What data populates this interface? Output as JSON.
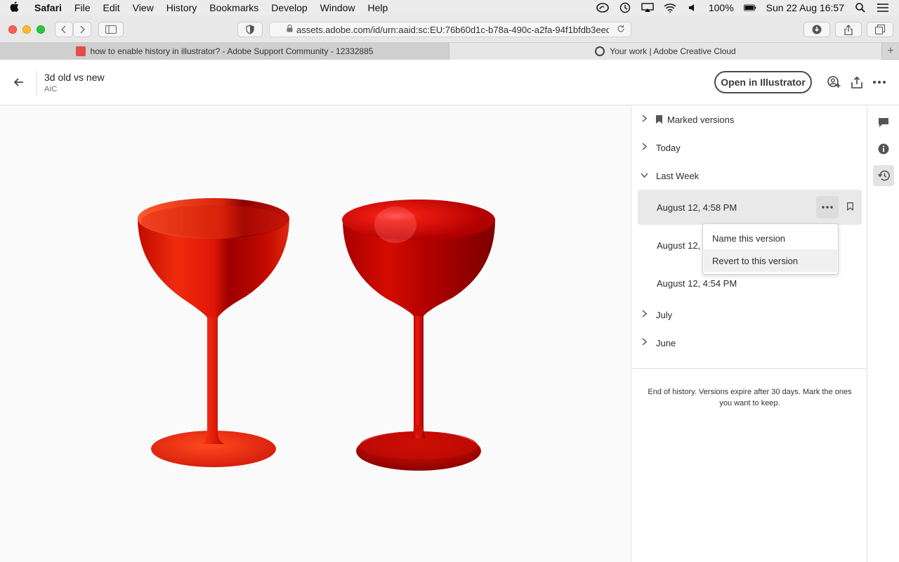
{
  "menubar": {
    "app_name": "Safari",
    "items": [
      "File",
      "Edit",
      "View",
      "History",
      "Bookmarks",
      "Develop",
      "Window",
      "Help"
    ],
    "battery": "100%",
    "clock": "Sun 22 Aug  16:57"
  },
  "toolbar": {
    "url": "assets.adobe.com/id/urn:aaid:sc:EU:76b60d1c-b78a-490c-a2fa-94f1bfdb3eed"
  },
  "tabs": [
    {
      "title": "how to enable history in illustrator? - Adobe Support Community - 12332885"
    },
    {
      "title": "Your work | Adobe Creative Cloud"
    }
  ],
  "header": {
    "title": "3d old vs new",
    "subtitle": "AIC",
    "open_button": "Open in Illustrator"
  },
  "versions_panel": {
    "groups": {
      "marked": "Marked versions",
      "today": "Today",
      "last_week": "Last Week",
      "july": "July",
      "june": "June"
    },
    "last_week_versions": [
      {
        "label": "August 12, 4:58 PM"
      },
      {
        "label": "August 12, 4:"
      },
      {
        "label": "August 12, 4:54 PM"
      }
    ],
    "end_note": "End of history. Versions expire after 30 days. Mark the ones you want to keep."
  },
  "context_menu": {
    "items": [
      "Name this version",
      "Revert to this version"
    ]
  },
  "colors": {
    "glass_red": "#d8100b",
    "glass_dark": "#8a0000",
    "accent_selected": "#e9e9e9"
  }
}
